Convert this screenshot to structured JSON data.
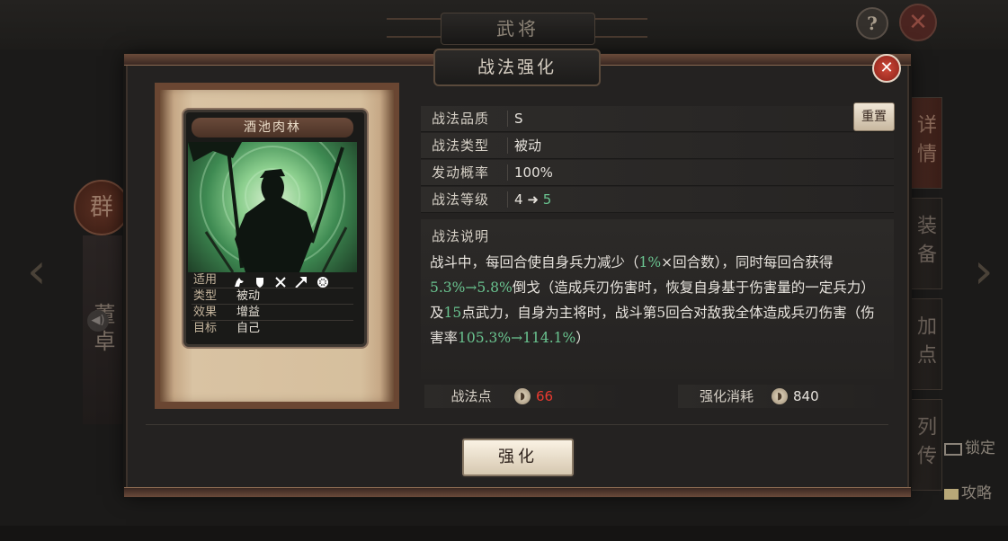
{
  "background": {
    "screen_title": "武将",
    "help_label": "?",
    "close_label": "✕",
    "faction": "群",
    "general_name": "董卓",
    "side_tabs": [
      "详情",
      "装备",
      "加点",
      "列传"
    ],
    "lock_label": "锁定",
    "guide_label": "攻略",
    "left_arrow": "‹",
    "right_arrow": "›"
  },
  "modal": {
    "title": "战法强化",
    "close_label": "✕"
  },
  "card": {
    "name": "酒池肉林",
    "rows": [
      {
        "key": "适用",
        "value": ""
      },
      {
        "key": "类型",
        "value": "被动"
      },
      {
        "key": "效果",
        "value": "增益"
      },
      {
        "key": "目标",
        "value": "自己"
      }
    ],
    "applicable_icons": [
      "cavalry-icon",
      "shield-icon",
      "crossed-swords-icon",
      "spear-icon",
      "wheel-icon"
    ]
  },
  "info": {
    "rows": [
      {
        "key": "战法品质",
        "value": "S"
      },
      {
        "key": "战法类型",
        "value": "被动"
      },
      {
        "key": "发动概率",
        "value": "100%"
      },
      {
        "key": "战法等级",
        "value_from": "4",
        "value_arrow": "➜",
        "value_to": "5"
      }
    ],
    "reset_label": "重置",
    "description_title": "战法说明",
    "description": {
      "p1": "战斗中，每回合使自身兵力减少（",
      "p1_hl": "1%",
      "p2": "×回合数），同时每回合获得",
      "p2_hl": "5.3%→5.8%",
      "p3": "倒戈（造成兵刃伤害时，恢复自身基于伤害量的一定兵力）及",
      "p3_hl": "15",
      "p4": "点武力，自身为主将时，战斗第5回合对敌我全体造成兵刃伤害（伤害率",
      "p4_hl": "105.3%→114.1%",
      "p5": "）"
    },
    "points_label": "战法点",
    "points_value": "66",
    "cost_label": "强化消耗",
    "cost_value": "840"
  },
  "enhance_label": "强化",
  "colors": {
    "highlight_green": "#6ac490",
    "insufficient_red": "#e83a30",
    "close_red": "#c8382c",
    "parchment": "#d9c3a3"
  }
}
